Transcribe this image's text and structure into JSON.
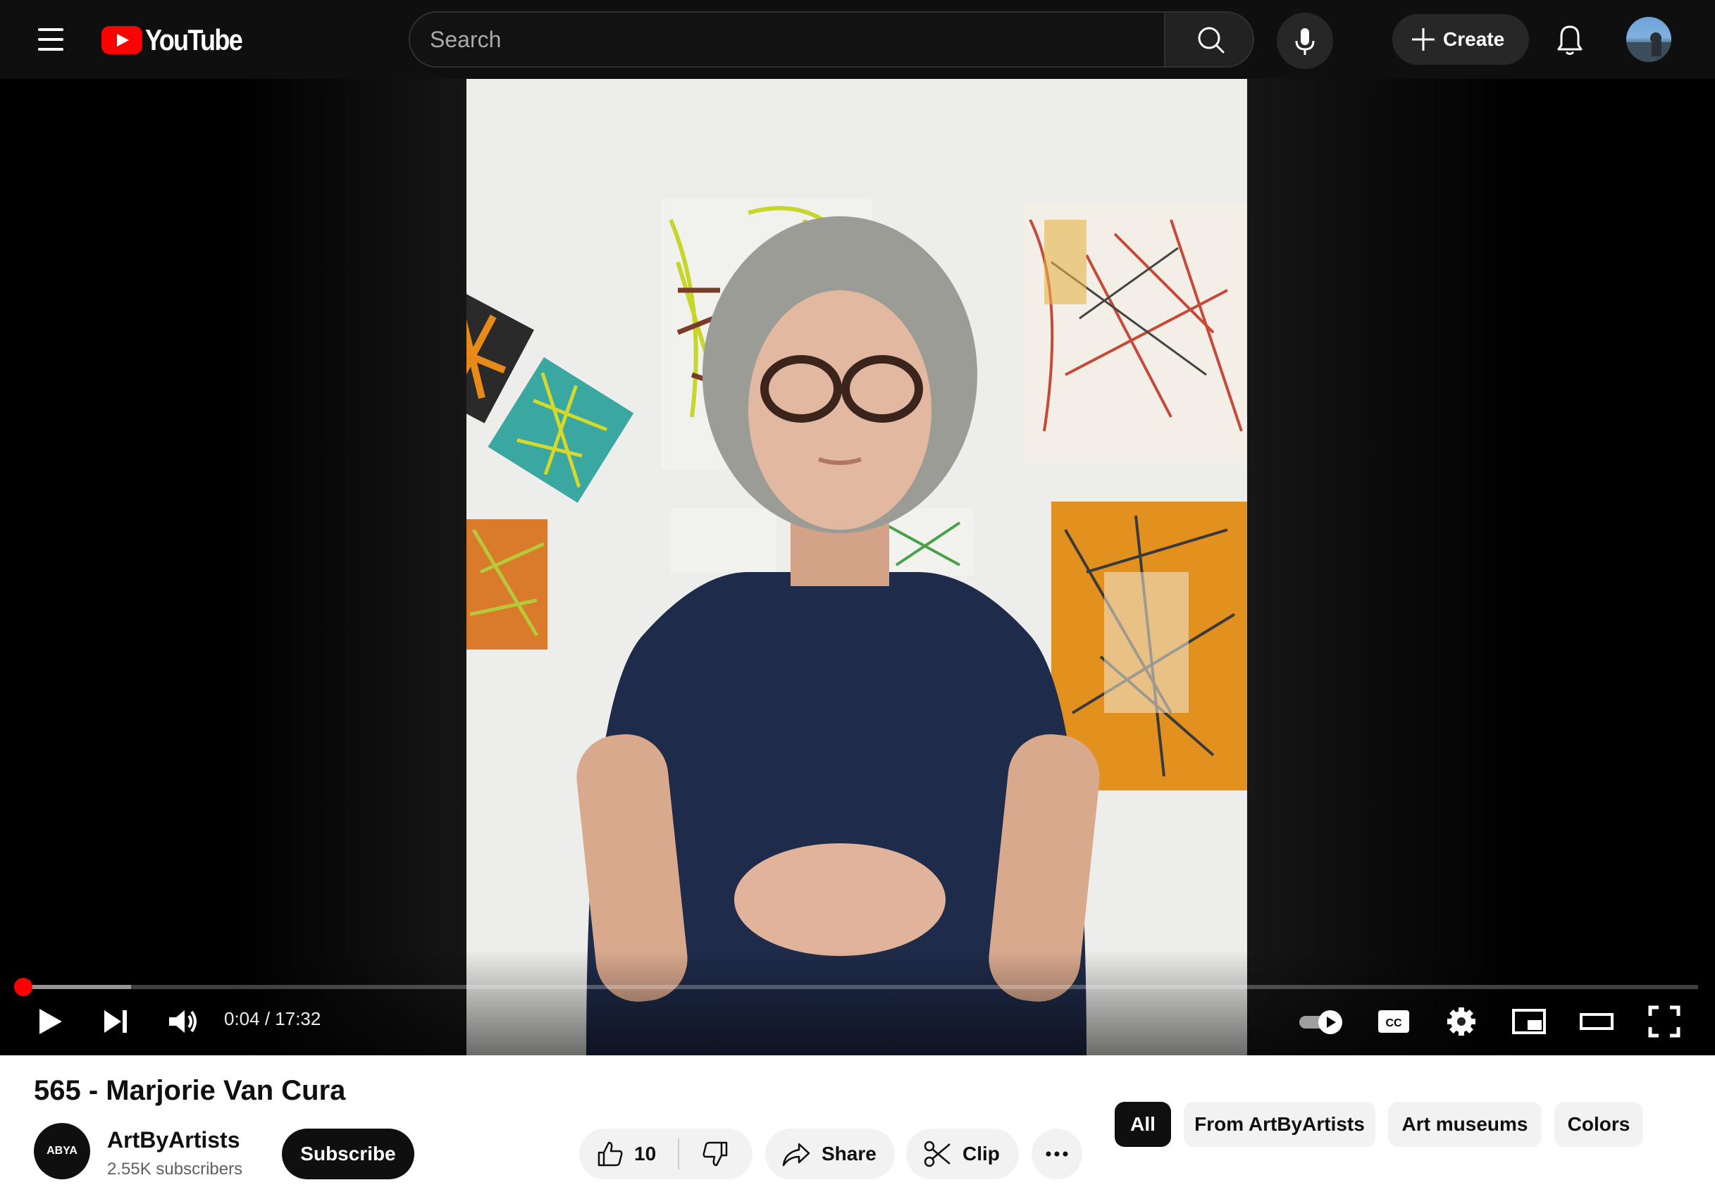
{
  "header": {
    "logo_text": "YouTube",
    "search_placeholder": "Search",
    "create_label": "Create"
  },
  "player": {
    "current_time": "0:04",
    "duration": "17:32",
    "time_display": "0:04 / 17:32",
    "progress_fraction": 0.0038,
    "autoplay_on": true
  },
  "video": {
    "title": "565 - Marjorie Van Cura"
  },
  "channel": {
    "avatar_text": "ABYA",
    "name": "ArtByArtists",
    "subscribers": "2.55K subscribers",
    "subscribe_label": "Subscribe"
  },
  "actions": {
    "like_count": "10",
    "share_label": "Share",
    "clip_label": "Clip"
  },
  "chips": [
    {
      "label": "All",
      "active": true
    },
    {
      "label": "From ArtByArtists",
      "active": false
    },
    {
      "label": "Art museums",
      "active": false
    },
    {
      "label": "Colors",
      "active": false
    }
  ],
  "colors": {
    "brand_red": "#ff0000",
    "header_bg": "#0f0f0f",
    "chip_bg": "#f2f2f2"
  }
}
